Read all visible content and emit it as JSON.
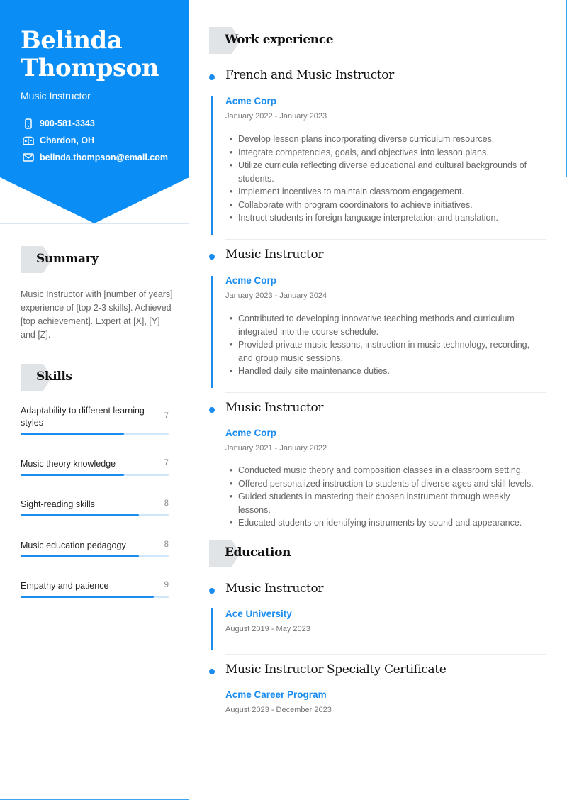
{
  "colors": {
    "accent": "#0a8df5",
    "tag_bg": "#e1e4e6",
    "bar_fill": "#1a8cf0",
    "bar_track": "#cfe6fb"
  },
  "header": {
    "first_name": "Belinda",
    "last_name": "Thompson",
    "role": "Music Instructor",
    "contacts": [
      {
        "icon": "phone-icon",
        "text": "900-581-3343"
      },
      {
        "icon": "mailbox-location-icon",
        "text": "Chardon, OH"
      },
      {
        "icon": "envelope-icon",
        "text": "belinda.thompson@email.com"
      }
    ]
  },
  "summary": {
    "title": "Summary",
    "text": "Music Instructor with [number of years] experience of [top 2-3 skills]. Achieved [top achievement]. Expert at [X], [Y] and [Z]."
  },
  "skills": {
    "title": "Skills",
    "max_score": 10,
    "items": [
      {
        "name": "Adaptability to different learning styles",
        "score": 7
      },
      {
        "name": "Music theory knowledge",
        "score": 7
      },
      {
        "name": "Sight-reading skills",
        "score": 8
      },
      {
        "name": "Music education pedagogy",
        "score": 8
      },
      {
        "name": "Empathy and patience",
        "score": 9
      }
    ]
  },
  "work": {
    "title": "Work experience",
    "items": [
      {
        "title": "French and Music Instructor",
        "org": "Acme Corp",
        "dates": "January 2022 - January 2023",
        "bullets": [
          "Develop lesson plans incorporating diverse curriculum resources.",
          "Integrate competencies, goals, and objectives into lesson plans.",
          "Utilize curricula reflecting diverse educational and cultural backgrounds of students.",
          "Implement incentives to maintain classroom engagement.",
          "Collaborate with program coordinators to achieve initiatives.",
          "Instruct students in foreign language interpretation and translation."
        ]
      },
      {
        "title": "Music Instructor",
        "org": "Acme Corp",
        "dates": "January 2023 - January 2024",
        "bullets": [
          "Contributed to developing innovative teaching methods and curriculum integrated into the course schedule.",
          "Provided private music lessons, instruction in music technology, recording, and group music sessions.",
          "Handled daily site maintenance duties."
        ]
      },
      {
        "title": "Music Instructor",
        "org": "Acme Corp",
        "dates": "January 2021 - January 2022",
        "bullets": [
          "Conducted music theory and composition classes in a classroom setting.",
          "Offered personalized instruction to students of diverse ages and skill levels.",
          "Guided students in mastering their chosen instrument through weekly lessons.",
          "Educated students on identifying instruments by sound and appearance."
        ]
      }
    ]
  },
  "education": {
    "title": "Education",
    "items": [
      {
        "title": "Music Instructor",
        "org": "Ace University",
        "dates": "August 2019 - May 2023"
      },
      {
        "title": "Music Instructor Specialty Certificate",
        "org": "Acme Career Program",
        "dates": "August 2023 - December 2023"
      }
    ]
  }
}
